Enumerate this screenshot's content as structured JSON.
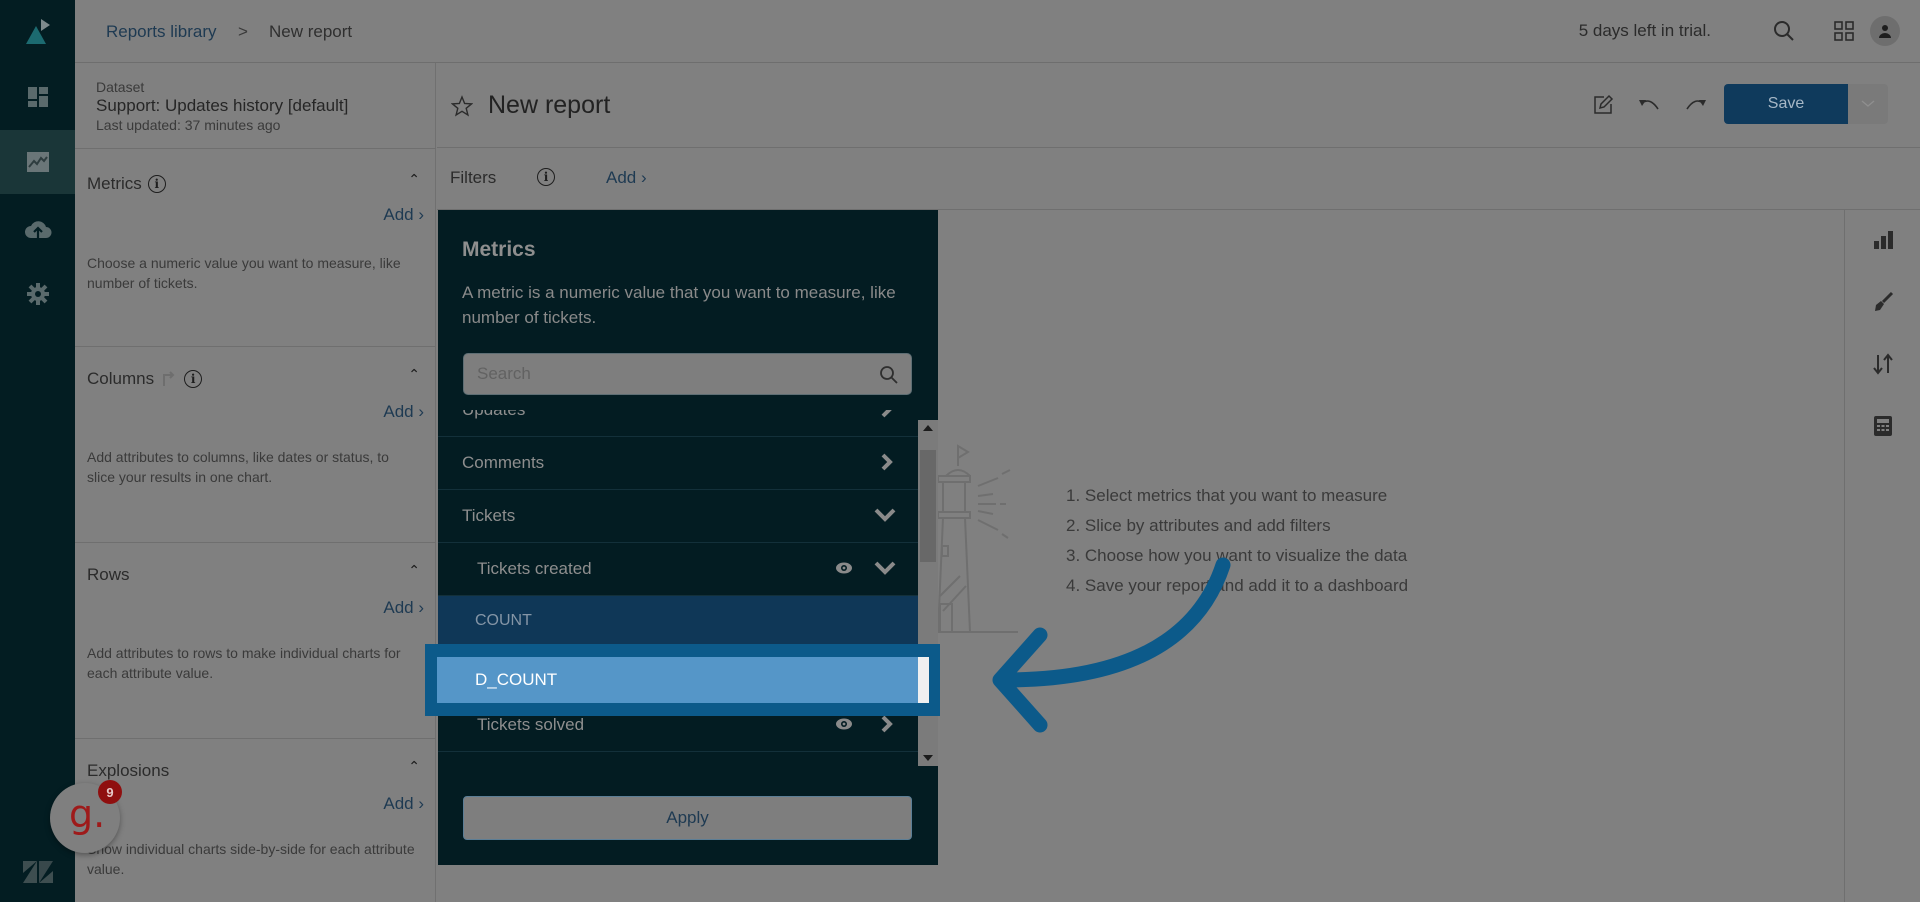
{
  "colors": {
    "rail_bg": "#031d22",
    "popup_bg": "#031c22",
    "link": "#1e3a52",
    "save_bg": "#0f3a5c",
    "highlight_frame": "#0c5a8a",
    "highlight_row": "#5596c8",
    "arrow": "#0c5a8a",
    "guide_badge": "#8f0f0f"
  },
  "rail": {
    "items": [
      {
        "icon": "zendesk-explore-logo-icon"
      },
      {
        "icon": "dashboard-icon"
      },
      {
        "icon": "reports-chart-icon",
        "active": true
      },
      {
        "icon": "upload-cloud-icon"
      },
      {
        "icon": "settings-gear-icon"
      },
      {
        "icon": "zendesk-logo-icon"
      }
    ]
  },
  "topbar": {
    "breadcrumb_root": "Reports library",
    "breadcrumb_sep": ">",
    "breadcrumb_current": "New report",
    "trial": "5 days left in trial.",
    "icons": [
      "search-icon",
      "apps-grid-icon",
      "user-avatar-icon"
    ]
  },
  "dataset": {
    "label": "Dataset",
    "name": "Support: Updates history [default]",
    "updated": "Last updated: 37 minutes ago"
  },
  "config": {
    "add_label": "Add ›",
    "sections": [
      {
        "title": "Metrics",
        "desc": "Choose a numeric value you want to measure, like number of tickets."
      },
      {
        "title": "Columns",
        "desc": "Add attributes to columns, like dates or status, to slice your results in one chart."
      },
      {
        "title": "Rows",
        "desc": "Add attributes to rows to make individual charts for each attribute value."
      },
      {
        "title": "Explosions",
        "desc": "Show individual charts side-by-side for each attribute value."
      }
    ]
  },
  "report": {
    "title": "New report",
    "save_label": "Save",
    "tools": [
      "edit-icon",
      "undo-icon",
      "redo-icon",
      "refresh-icon"
    ]
  },
  "filters": {
    "label": "Filters",
    "add_label": "Add ›"
  },
  "right_toolbar": [
    "chart-type-icon",
    "paintbrush-icon",
    "sort-icon",
    "calculator-icon"
  ],
  "empty_state": {
    "steps": [
      "1. Select metrics that you want to measure",
      "2. Slice by attributes and add filters",
      "3. Choose how you want to visualize the data",
      "4. Save your report and add it to a dashboard"
    ]
  },
  "metrics_popup": {
    "title": "Metrics",
    "desc": "A metric is a numeric value that you want to measure, like number of tickets.",
    "search_placeholder": "Search",
    "search_value": "",
    "rows": [
      {
        "label": "Updates",
        "type": "group",
        "state": "collapsed"
      },
      {
        "label": "Comments",
        "type": "group",
        "state": "collapsed"
      },
      {
        "label": "Tickets",
        "type": "group",
        "state": "expanded"
      },
      {
        "label": "Tickets created",
        "type": "metric",
        "state": "expanded",
        "eye": true
      },
      {
        "label": "COUNT",
        "type": "aggregator"
      },
      {
        "label": "D_COUNT",
        "type": "aggregator",
        "highlighted": true
      },
      {
        "label": "Tickets solved",
        "type": "metric",
        "state": "collapsed",
        "eye": true
      }
    ],
    "apply_label": "Apply"
  },
  "guide_widget": {
    "letter": "g.",
    "badge": "9"
  }
}
